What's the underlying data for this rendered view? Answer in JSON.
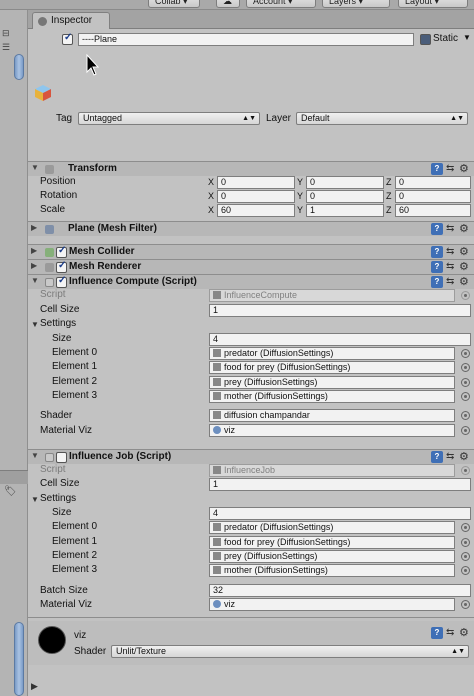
{
  "toolbar": {
    "collab": "Collab ▾",
    "account": "Account ▾",
    "layers": "Layers ▾",
    "layout": "Layout ▾"
  },
  "inspector": {
    "tab_label": "Inspector",
    "object": {
      "name": "----Plane",
      "active": true,
      "static_label": "Static",
      "tag_label": "Tag",
      "tag_value": "Untagged",
      "layer_label": "Layer",
      "layer_value": "Default"
    },
    "transform": {
      "title": "Transform",
      "rows": [
        {
          "label": "Position",
          "x": "0",
          "y": "0",
          "z": "0"
        },
        {
          "label": "Rotation",
          "x": "0",
          "y": "0",
          "z": "0"
        },
        {
          "label": "Scale",
          "x": "60",
          "y": "1",
          "z": "60"
        }
      ],
      "axes": [
        "X",
        "Y",
        "Z"
      ]
    },
    "mesh_filter": {
      "title": "Plane (Mesh Filter)"
    },
    "mesh_collider": {
      "title": "Mesh Collider",
      "enabled": true
    },
    "mesh_renderer": {
      "title": "Mesh Renderer",
      "enabled": true
    },
    "influence_compute": {
      "title": "Influence Compute (Script)",
      "enabled": true,
      "script_label": "Script",
      "script_value": "InfluenceCompute",
      "cell_size_label": "Cell Size",
      "cell_size": "1",
      "settings_label": "Settings",
      "size_label": "Size",
      "size": "4",
      "elements": [
        {
          "label": "Element 0",
          "value": "predator (DiffusionSettings)"
        },
        {
          "label": "Element 1",
          "value": "food for prey (DiffusionSettings)"
        },
        {
          "label": "Element 2",
          "value": "prey (DiffusionSettings)"
        },
        {
          "label": "Element 3",
          "value": "mother (DiffusionSettings)"
        }
      ],
      "shader_label": "Shader",
      "shader_value": "diffusion champandar",
      "material_label": "Material Viz",
      "material_value": "viz"
    },
    "influence_job": {
      "title": "Influence Job (Script)",
      "enabled": false,
      "script_label": "Script",
      "script_value": "InfluenceJob",
      "cell_size_label": "Cell Size",
      "cell_size": "1",
      "settings_label": "Settings",
      "size_label": "Size",
      "size": "4",
      "elements": [
        {
          "label": "Element 0",
          "value": "predator (DiffusionSettings)"
        },
        {
          "label": "Element 1",
          "value": "food for prey (DiffusionSettings)"
        },
        {
          "label": "Element 2",
          "value": "prey (DiffusionSettings)"
        },
        {
          "label": "Element 3",
          "value": "mother (DiffusionSettings)"
        }
      ],
      "batch_size_label": "Batch Size",
      "batch_size": "32",
      "material_label": "Material Viz",
      "material_value": "viz"
    },
    "material": {
      "name": "viz",
      "shader_label": "Shader",
      "shader_value": "Unlit/Texture"
    }
  },
  "icons": {
    "help": "?",
    "preset": "⇆",
    "gear": "⚙"
  },
  "colors": {
    "scroll_accent": "#7a9bc7",
    "help_icon": "#3f6fb6",
    "panel_bg": "#c2c2c2"
  }
}
